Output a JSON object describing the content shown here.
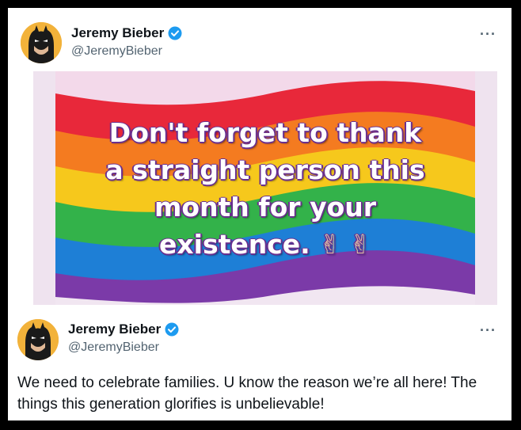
{
  "post1": {
    "name": "Jeremy Bieber",
    "handle": "@JeremyBieber",
    "more": "···",
    "image_text_lines": [
      "Don't forget to thank",
      "a straight person this",
      "month for your",
      "existence."
    ],
    "image_emoji": "✌ ✌"
  },
  "post2": {
    "name": "Jeremy Bieber",
    "handle": "@JeremyBieber",
    "more": "···",
    "text": "We need to celebrate families. U know the reason we’re all here!  The things this generation glorifies is unbelievable!"
  },
  "colors": {
    "verified": "#1d9bf0",
    "rainbow": [
      "#e8283a",
      "#f47b20",
      "#f6c81c",
      "#33b24a",
      "#1e7fd6",
      "#7b3aa8"
    ]
  }
}
